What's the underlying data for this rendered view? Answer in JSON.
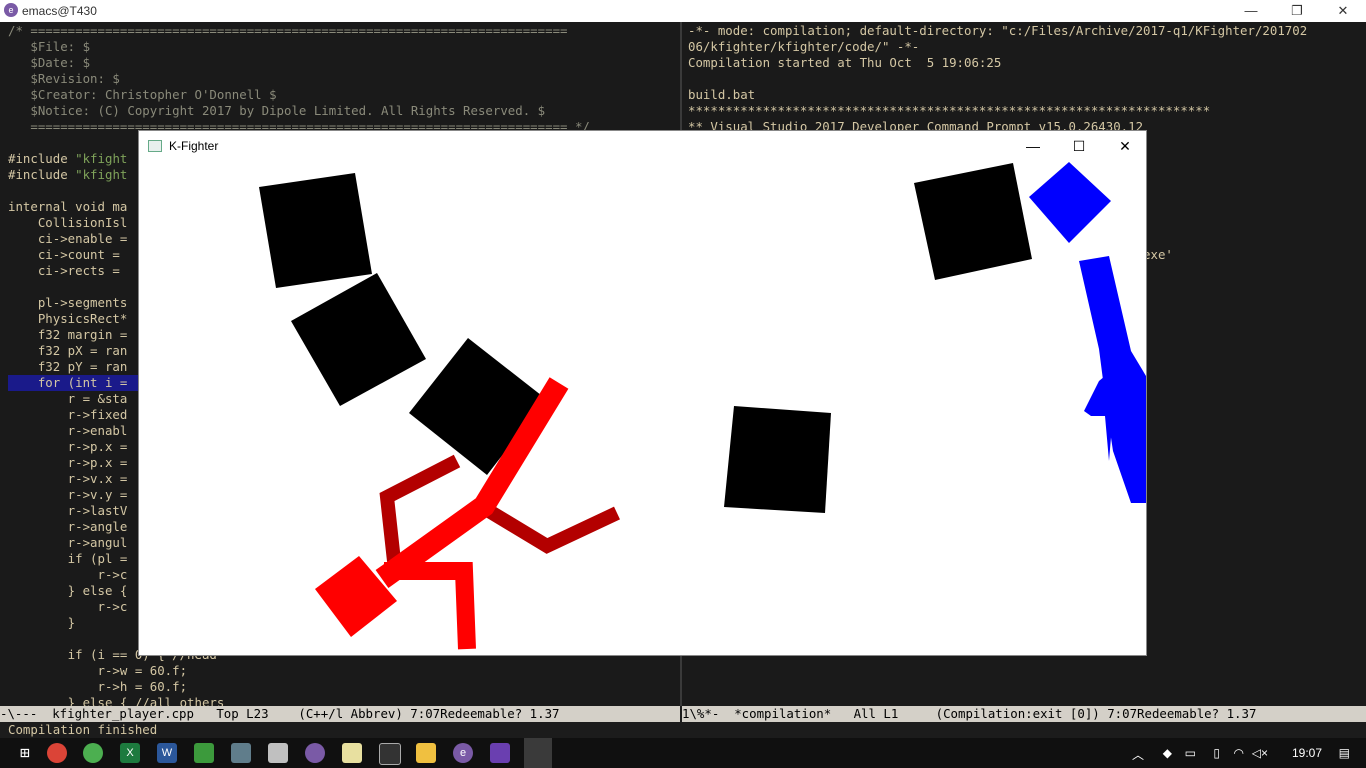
{
  "emacs": {
    "title": "emacs@T430",
    "colors": {
      "background": "#1a1a1a",
      "code": "#d4c7a4",
      "comment": "#8a8a7a",
      "string": "#7fa35a",
      "highlight": "#1a1a8a",
      "modeline": "#d4d0c8"
    },
    "left_lines": [
      "/* ========================================================================",
      "   $File: $",
      "   $Date: $",
      "   $Revision: $",
      "   $Creator: Christopher O'Donnell $",
      "   $Notice: (C) Copyright 2017 by Dipole Limited. All Rights Reserved. $",
      "   ======================================================================== */",
      "",
      "#include \"kfight",
      "#include \"kfight",
      "",
      "internal void ma",
      "    CollisionIsl",
      "    ci->enable = ",
      "    ci->count = ",
      "    ci->rects = ",
      "",
      "    pl->segments",
      "    PhysicsRect*",
      "    f32 margin = ",
      "    f32 pX = ran",
      "    f32 pY = ran",
      "    for (int i =",
      "        r = &sta",
      "        r->fixed",
      "        r->enabl",
      "        r->p.x =",
      "        r->p.x =",
      "        r->v.x =",
      "        r->v.y =",
      "        r->lastV",
      "        r->angle",
      "        r->angul",
      "        if (pl =",
      "            r->c",
      "        } else {",
      "            r->c",
      "        }",
      "",
      "        if (i == 0) { //head",
      "            r->w = 60.f;",
      "            r->h = 60.f;",
      "        } else { //all others"
    ],
    "right_lines": [
      "-*- mode: compilation; default-directory: \"c:/Files/Archive/2017-q1/KFighter/201702",
      "06/kfighter/kfighter/code/\" -*-",
      "Compilation started at Thu Oct  5 19:06:25",
      "",
      "build.bat",
      "**********************************************************************",
      "** Visual Studio 2017 Developer Command Prompt v15.0.26430.12",
      "",
      "",
      "",
      "",
      "",
      "",
      "",
      "                                                          er.exe'"
    ],
    "modeline_left": "-\\---  kfighter_player.cpp   Top L23    (C++/l Abbrev) 7:07Redeemable? 1.37",
    "modeline_right": "1\\%*-  *compilation*   All L1     (Compilation:exit [0]) 7:07Redeemable? 1.37",
    "minibuffer": "Compilation finished"
  },
  "game": {
    "title": "K-Fighter",
    "minimize_label": "—",
    "maximize_label": "☐",
    "close_label": "✕",
    "colors": {
      "box": "#000000",
      "red_player": "#ff0000",
      "red_dark": "#b30000",
      "blue_player": "#0000ff"
    }
  },
  "taskbar": {
    "icons": [
      "start-icon",
      "chrome-icon",
      "browser-icon",
      "excel-icon",
      "word-icon",
      "app-icon",
      "presentation-icon",
      "paint-icon",
      "discord-icon",
      "notepad-icon",
      "cmd-icon",
      "folder-icon",
      "emacs-icon",
      "visual-studio-icon",
      "kfighter-icon"
    ],
    "time": "19:07"
  }
}
